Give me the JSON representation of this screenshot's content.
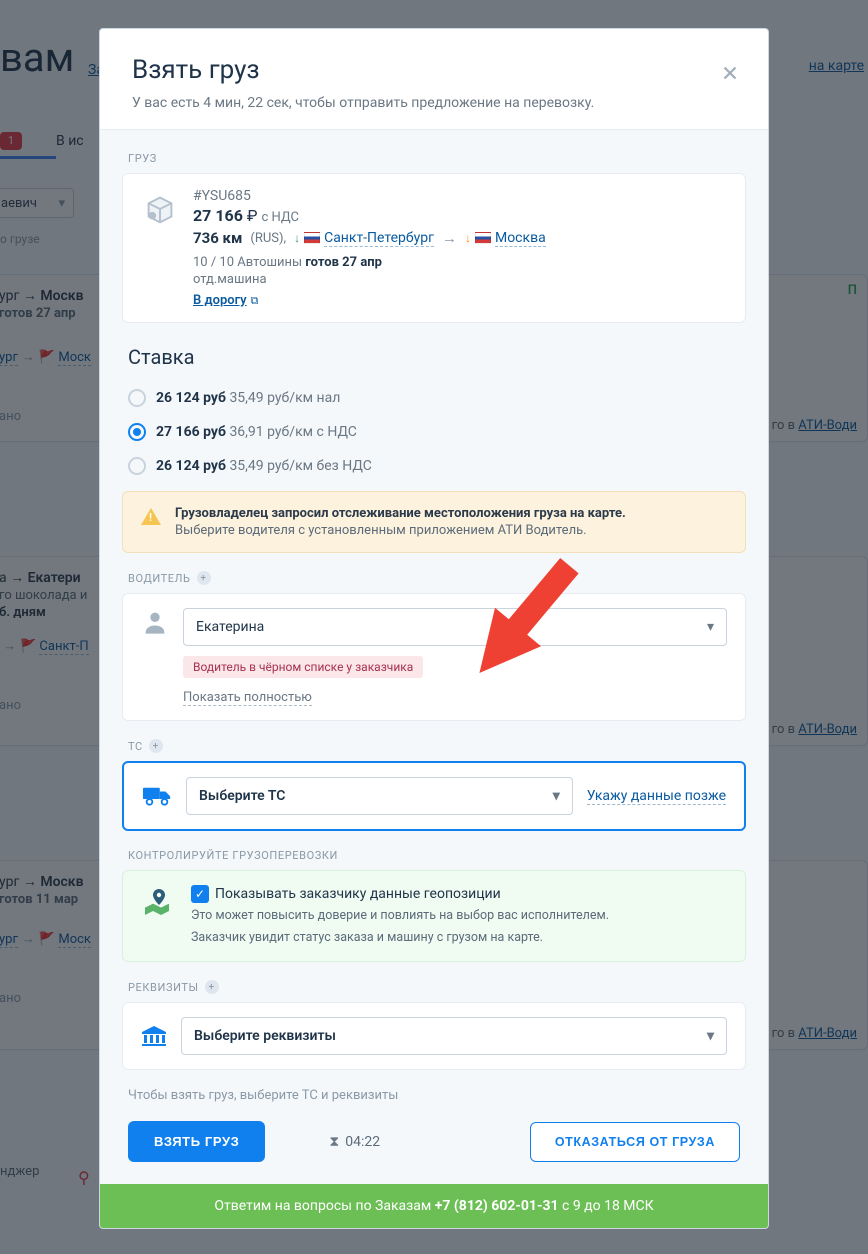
{
  "bg": {
    "title_fragment": "вам",
    "header_under": "За",
    "map_link": "на карте",
    "tab_badge": "1",
    "tab_exec": "В ис",
    "filter_value": "аевич",
    "search_label": "о грузе",
    "card1": {
      "route_from": "ург",
      "route_to": "Москв",
      "ready": "готов 27 апр",
      "from_city": "ург",
      "to_city": "Моск",
      "delivered": "ано",
      "status_fragment": "П",
      "ati": "го в",
      "ati_link": "АТИ-Води"
    },
    "card2": {
      "route_from": "а",
      "route_to": "Екатери",
      "choco": "го шоколада и",
      "days": "б. дням",
      "from_city": "",
      "to_city": "Санкт-П",
      "delivered": "ано",
      "ati": "го в",
      "ati_link": "АТИ-Води"
    },
    "card3": {
      "route_from": "ург",
      "route_to": "Москв",
      "ready": "готов 11 мар",
      "from_city": "ург",
      "to_city": "Моск",
      "delivered": "ано",
      "ati": "го в",
      "ati_link": "АТИ-Води"
    },
    "djr": "нджер"
  },
  "modal": {
    "title": "Взять груз",
    "subtitle": "У вас есть 4 мин, 22 сек, чтобы отправить предложение на перевозку."
  },
  "cargo": {
    "section": "ГРУЗ",
    "id": "#YSU685",
    "price": "27 166",
    "currency": "₽",
    "vat_label": "с НДС",
    "distance": "736 км",
    "country": "(RUS),",
    "from": "Санкт-Петербург",
    "to": "Москва",
    "tyres": "10 / 10 Автошины",
    "ready_bold": "готов 27 апр",
    "vehicle_note": "отд.машина",
    "road_link": "В дорогу"
  },
  "rate": {
    "title": "Ставка",
    "opt1": {
      "price": "26 124 руб",
      "perkm": "35,49 руб/км",
      "type": "нал"
    },
    "opt2": {
      "price": "27 166 руб",
      "perkm": "36,91 руб/км",
      "type": "с НДС"
    },
    "opt3": {
      "price": "26 124 руб",
      "perkm": "35,49 руб/км",
      "type": "без НДС"
    }
  },
  "warn": {
    "title": "Грузовладелец запросил отслеживание местоположения груза на карте.",
    "sub": "Выберите водителя с установленным приложением АТИ Водитель."
  },
  "driver": {
    "section": "ВОДИТЕЛЬ",
    "selected": "Екатерина",
    "blacklist": "Водитель в чёрном списке у заказчика",
    "show_full": "Показать полностью"
  },
  "ts": {
    "section": "ТС",
    "placeholder": "Выберите ТС",
    "later_link": "Укажу данные позже"
  },
  "geo": {
    "section": "КОНТРОЛИРУЙТЕ ГРУЗОПЕРЕВОЗКИ",
    "check_label": "Показывать заказчику данные геопозиции",
    "sub1": "Это может повысить доверие и повлиять на выбор вас исполнителем.",
    "sub2": "Заказчик увидит статус заказа и машину с грузом на карте."
  },
  "req": {
    "section": "РЕКВИЗИТЫ",
    "placeholder": "Выберите реквизиты"
  },
  "hint": "Чтобы взять груз, выберите ТС и реквизиты",
  "buttons": {
    "take": "ВЗЯТЬ ГРУЗ",
    "timer": "04:22",
    "refuse": "ОТКАЗАТЬСЯ ОТ ГРУЗА"
  },
  "green": {
    "prefix": "Ответим на вопросы по Заказам",
    "phone": "+7 (812) 602-01-31",
    "hours": "с 9 до 18 МСК"
  }
}
